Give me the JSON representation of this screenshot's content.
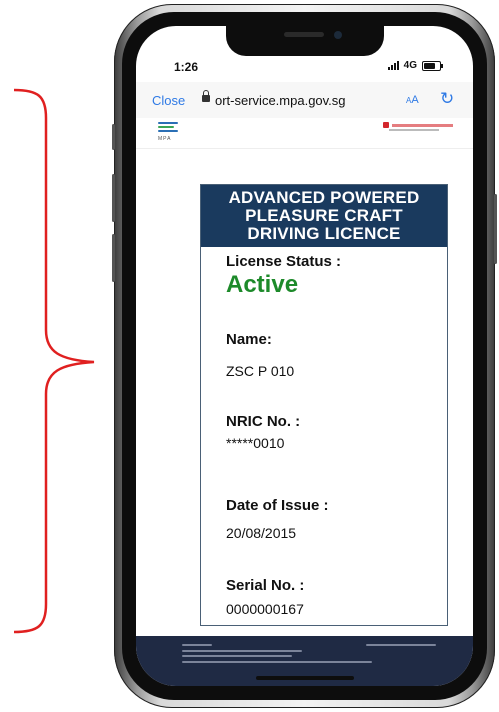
{
  "status_bar": {
    "time": "1:26",
    "network": "4G"
  },
  "browser": {
    "close_label": "Close",
    "url": "ort-service.mpa.gov.sg",
    "text_size_label": "AA",
    "reload_icon": "reload-icon",
    "lock_icon": "lock-icon"
  },
  "site_header": {
    "logo_text": "MPA"
  },
  "licence_card": {
    "title_lines": [
      "ADVANCED POWERED",
      "PLEASURE CRAFT",
      "DRIVING LICENCE"
    ],
    "status_label": "License Status :",
    "status_value": "Active",
    "name_label": "Name:",
    "name_value": "ZSC P 010",
    "nric_label": "NRIC No. :",
    "nric_value": "*****0010",
    "issue_label": "Date of Issue :",
    "issue_value": "20/08/2015",
    "serial_label": "Serial No. :",
    "serial_value": "0000000167"
  },
  "colors": {
    "title_bar": "#1a3a5e",
    "active_green": "#1d8a2a",
    "link_blue": "#2f7ae5",
    "bracket_red": "#e02020",
    "footer": "#1f2a44"
  }
}
